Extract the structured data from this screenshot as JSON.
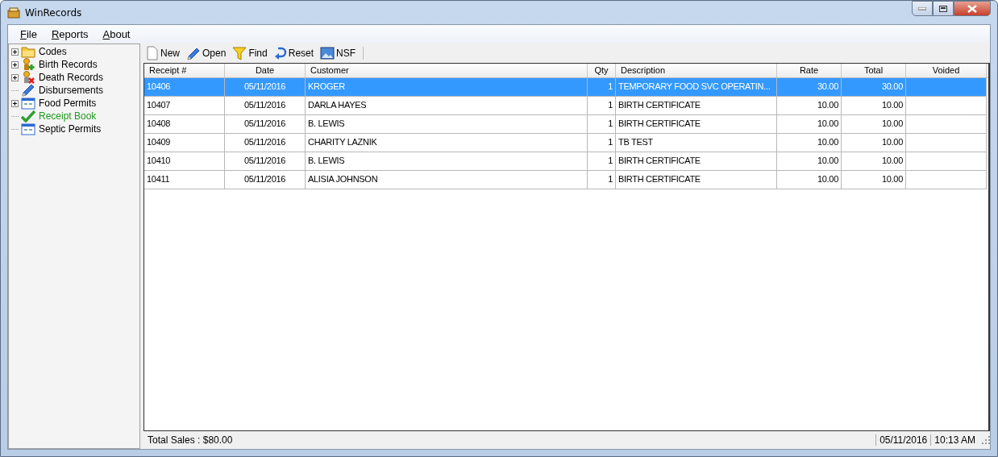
{
  "window": {
    "title": "WinRecords"
  },
  "menu": [
    "File",
    "Reports",
    "About"
  ],
  "tree": [
    {
      "label": "Codes",
      "kind": "folder",
      "expandable": true,
      "selected": false
    },
    {
      "label": "Birth Records",
      "kind": "person-add",
      "expandable": true,
      "selected": false
    },
    {
      "label": "Death Records",
      "kind": "person-remove",
      "expandable": true,
      "selected": false
    },
    {
      "label": "Disbursements",
      "kind": "pencil",
      "expandable": false,
      "selected": false
    },
    {
      "label": "Food Permits",
      "kind": "form",
      "expandable": true,
      "selected": false
    },
    {
      "label": "Receipt Book",
      "kind": "check",
      "expandable": false,
      "selected": true
    },
    {
      "label": "Septic Permits",
      "kind": "form",
      "expandable": false,
      "selected": false
    }
  ],
  "toolbar": [
    {
      "label": "New",
      "kind": "page"
    },
    {
      "label": "Open",
      "kind": "pencil"
    },
    {
      "label": "Find",
      "kind": "funnel"
    },
    {
      "label": "Reset",
      "kind": "undo"
    },
    {
      "label": "NSF",
      "kind": "image"
    }
  ],
  "table": {
    "columns": [
      "Receipt #",
      "Date",
      "Customer",
      "Qty",
      "Description",
      "Rate",
      "Total",
      "Voided"
    ],
    "rows": [
      {
        "selected": true,
        "cells": [
          "10406",
          "05/11/2016",
          "KROGER",
          "1",
          "TEMPORARY FOOD SVC OPERATIN...",
          "30.00",
          "30.00"
        ]
      },
      {
        "selected": false,
        "cells": [
          "10407",
          "05/11/2016",
          "DARLA HAYES",
          "1",
          "BIRTH CERTIFICATE",
          "10.00",
          "10.00"
        ]
      },
      {
        "selected": false,
        "cells": [
          "10408",
          "05/11/2016",
          "B. LEWIS",
          "1",
          "BIRTH CERTIFICATE",
          "10.00",
          "10.00"
        ]
      },
      {
        "selected": false,
        "cells": [
          "10409",
          "05/11/2016",
          "CHARITY LAZNIK",
          "1",
          "TB TEST",
          "10.00",
          "10.00"
        ]
      },
      {
        "selected": false,
        "cells": [
          "10410",
          "05/11/2016",
          "B. LEWIS",
          "1",
          "BIRTH CERTIFICATE",
          "10.00",
          "10.00"
        ]
      },
      {
        "selected": false,
        "cells": [
          "10411",
          "05/11/2016",
          "ALISIA JOHNSON",
          "1",
          "BIRTH CERTIFICATE",
          "10.00",
          "10.00"
        ]
      }
    ]
  },
  "status_bar": {
    "total": "Total Sales : $80.00",
    "date": "05/11/2016",
    "time": "10:13 AM"
  }
}
